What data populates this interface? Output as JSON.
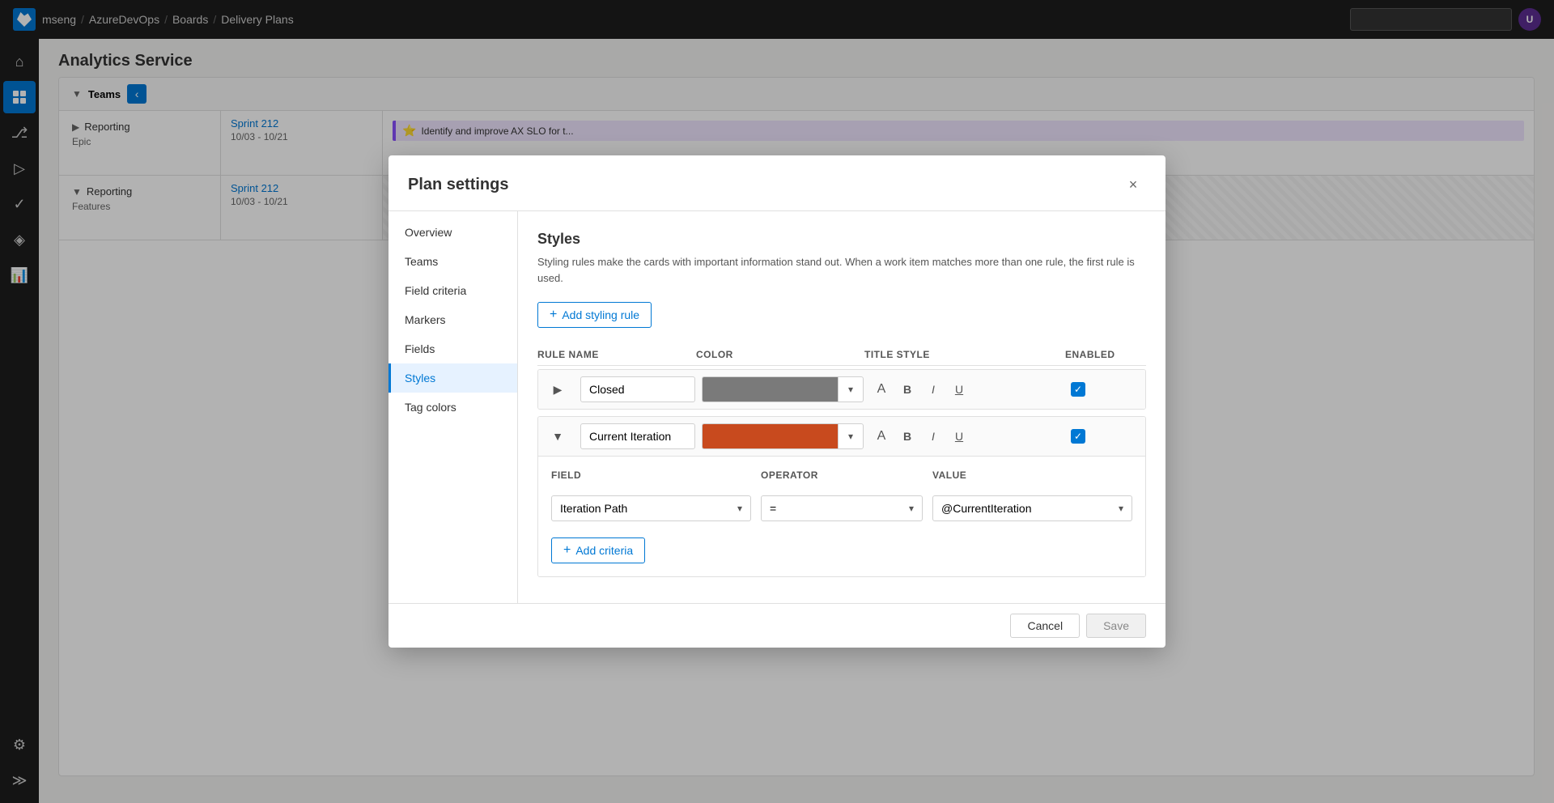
{
  "topbar": {
    "org": "mseng",
    "sep1": "/",
    "project": "AzureDevOps",
    "sep2": "/",
    "section": "Boards",
    "sep3": "/",
    "page": "Delivery Plans"
  },
  "page": {
    "title": "Analytics Service"
  },
  "sidebar": {
    "icons": [
      {
        "name": "home-icon",
        "glyph": "⌂"
      },
      {
        "name": "boards-icon",
        "glyph": "☰"
      },
      {
        "name": "repos-icon",
        "glyph": "⎇"
      },
      {
        "name": "pipelines-icon",
        "glyph": "▷"
      },
      {
        "name": "testplans-icon",
        "glyph": "✓"
      },
      {
        "name": "artifacts-icon",
        "glyph": "◈"
      },
      {
        "name": "analytics-icon",
        "glyph": "📊"
      }
    ],
    "bottom": [
      {
        "name": "settings-icon",
        "glyph": "⚙"
      },
      {
        "name": "expand-icon",
        "glyph": "≫"
      }
    ]
  },
  "plan": {
    "teams_label": "Teams",
    "rows": [
      {
        "team": "Reporting",
        "type": "Epic",
        "sprint": "Sprint 212",
        "dates": "10/03 - 10/21",
        "work_item": "Identify and improve AX SLO for t..."
      },
      {
        "team": "Reporting",
        "type": "Features",
        "sprint": "Sprint 212",
        "dates": "10/03 - 10/21"
      }
    ]
  },
  "dialog": {
    "title": "Plan settings",
    "close_label": "×",
    "nav": [
      {
        "id": "overview",
        "label": "Overview"
      },
      {
        "id": "teams",
        "label": "Teams"
      },
      {
        "id": "field-criteria",
        "label": "Field criteria"
      },
      {
        "id": "markers",
        "label": "Markers"
      },
      {
        "id": "fields",
        "label": "Fields"
      },
      {
        "id": "styles",
        "label": "Styles",
        "active": true
      },
      {
        "id": "tag-colors",
        "label": "Tag colors"
      }
    ],
    "content": {
      "section_title": "Styles",
      "section_desc": "Styling rules make the cards with important information stand out. When a work item matches more than one rule, the first rule is used.",
      "add_button": "Add styling rule",
      "table": {
        "col_rule_name": "Rule name",
        "col_color": "Color",
        "col_title_style": "Title style",
        "col_enabled": "Enabled"
      },
      "rules": [
        {
          "id": "closed",
          "name": "Closed",
          "color": "#7a7a7a",
          "enabled": true,
          "expanded": false,
          "criteria": []
        },
        {
          "id": "current-iteration",
          "name": "Current Iteration",
          "color": "#c84a1e",
          "enabled": true,
          "expanded": true,
          "criteria": [
            {
              "field": "Iteration Path",
              "operator": "=",
              "value": "@CurrentIteration"
            }
          ]
        }
      ],
      "field_label": "Field",
      "operator_label": "Operator",
      "value_label": "Value",
      "field_value": "Iteration Path",
      "operator_value": "=",
      "value_value": "@CurrentIteration",
      "add_criteria_btn": "Add criteria"
    },
    "footer": {
      "cancel_label": "Cancel",
      "save_label": "Save"
    }
  }
}
